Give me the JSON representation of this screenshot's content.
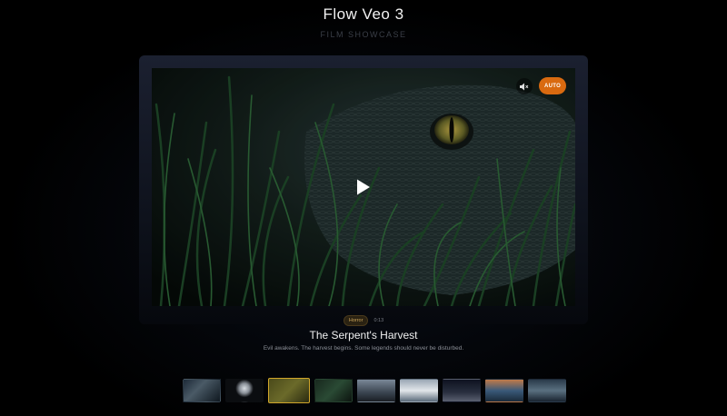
{
  "header": {
    "title": "Flow Veo 3",
    "subtitle": "FILM SHOWCASE"
  },
  "player": {
    "mute_icon": "speaker-muted-icon",
    "auto_label": "AUTO",
    "play_icon": "play-icon"
  },
  "film": {
    "genre": "Horror",
    "duration": "0:13",
    "title": "The Serpent's Harvest",
    "description": "Evil awakens. The harvest begins. Some legends should never be disturbed."
  },
  "thumbnails": [
    {
      "name": "thumb-1",
      "active": false
    },
    {
      "name": "thumb-2",
      "active": false
    },
    {
      "name": "thumb-3",
      "active": true
    },
    {
      "name": "thumb-4",
      "active": false
    },
    {
      "name": "thumb-5",
      "active": false
    },
    {
      "name": "thumb-6",
      "active": false
    },
    {
      "name": "thumb-7",
      "active": false
    },
    {
      "name": "thumb-8",
      "active": false
    },
    {
      "name": "thumb-9",
      "active": false
    }
  ],
  "colors": {
    "accent": "#d96a10",
    "active_border": "#d1a62a",
    "genre_text": "#c9a35a"
  }
}
